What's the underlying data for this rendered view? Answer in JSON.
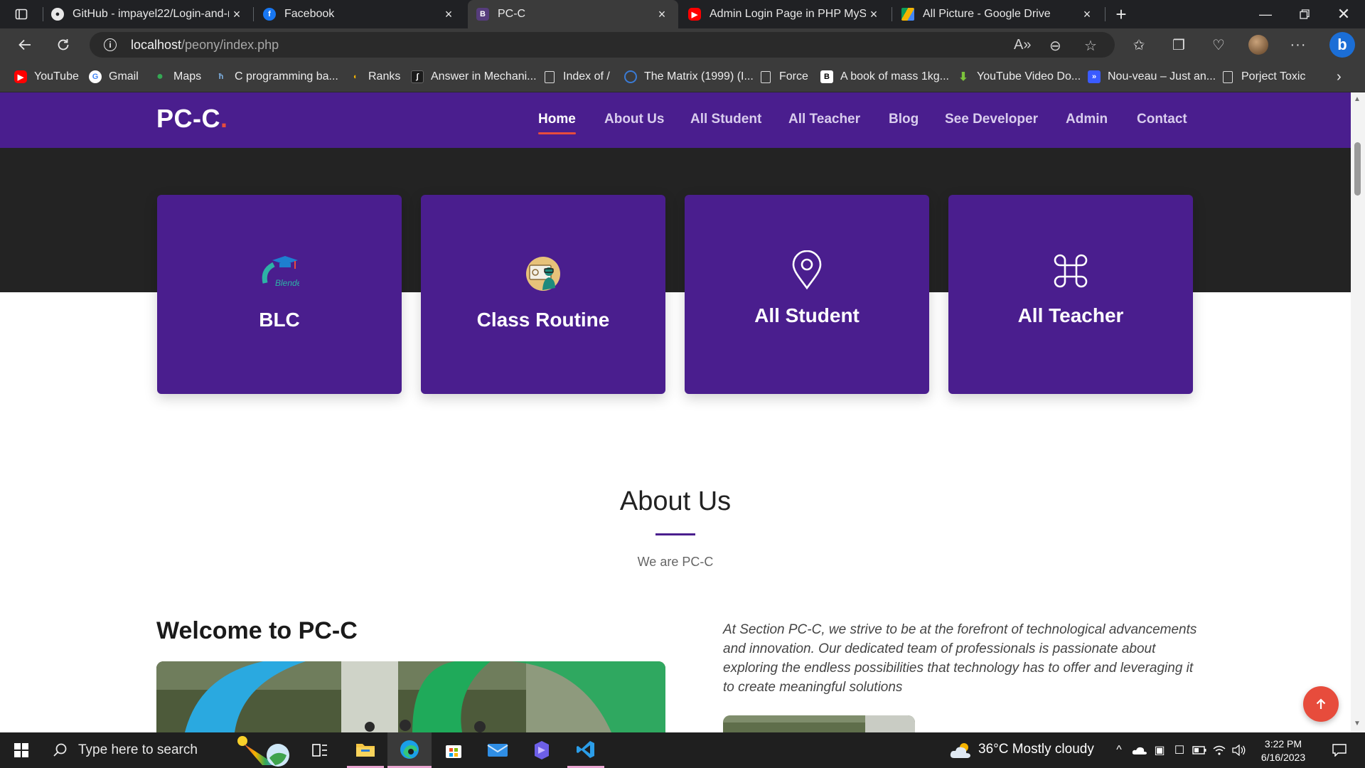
{
  "browser": {
    "tabs": [
      {
        "title": "GitHub - impayel22/Login-and-r",
        "icon": "github-icon",
        "active": false
      },
      {
        "title": "Facebook",
        "icon": "facebook-icon",
        "active": false
      },
      {
        "title": "PC-C",
        "icon": "bootstrap-icon",
        "active": true
      },
      {
        "title": "Admin Login Page in PHP MySQL",
        "icon": "youtube-icon",
        "active": false
      },
      {
        "title": "All Picture - Google Drive",
        "icon": "google-drive-icon",
        "active": false
      }
    ],
    "url_host": "localhost",
    "url_path": "/peony/index.php",
    "bookmarks": [
      {
        "label": "YouTube",
        "icon": "youtube-icon"
      },
      {
        "label": "Gmail",
        "icon": "google-icon"
      },
      {
        "label": "Maps",
        "icon": "maps-icon"
      },
      {
        "label": "C programming ba...",
        "icon": "site-icon"
      },
      {
        "label": "Ranks",
        "icon": "ranks-icon"
      },
      {
        "label": "Answer in Mechani...",
        "icon": "answer-icon"
      },
      {
        "label": "Index of /",
        "icon": "page-icon"
      },
      {
        "label": "The Matrix (1999) (I...",
        "icon": "matrix-icon"
      },
      {
        "label": "Force",
        "icon": "page-icon"
      },
      {
        "label": "A book of mass 1kg...",
        "icon": "brainly-icon"
      },
      {
        "label": "YouTube Video Do...",
        "icon": "download-icon"
      },
      {
        "label": "Nou-veau – Just an...",
        "icon": "nouveau-icon"
      },
      {
        "label": "Porject Toxic",
        "icon": "page-icon"
      }
    ]
  },
  "site": {
    "logo": "PC-C",
    "logo_dot": ".",
    "menu": [
      "Home",
      "About Us",
      "All Student",
      "All Teacher",
      "Blog",
      "See Developer",
      "Admin",
      "Contact"
    ],
    "active_menu": "Home",
    "cards": [
      {
        "title": "BLC",
        "icon": "blended-learning-icon"
      },
      {
        "title": "Class Routine",
        "icon": "class-routine-icon"
      },
      {
        "title": "All Student",
        "icon": "location-pin-icon"
      },
      {
        "title": "All Teacher",
        "icon": "command-icon"
      }
    ],
    "about": {
      "title": "About Us",
      "subtitle": "We are PC-C"
    },
    "welcome_title": "Welcome to PC-C",
    "intro": "At Section PC-C, we strive to be at the forefront of technological advancements and innovation. Our dedicated team of professionals is passionate about exploring the endless possibilities that technology has to offer and leveraging it to create meaningful solutions",
    "blc_icon_text": "Blended"
  },
  "taskbar": {
    "search_placeholder": "Type here to search",
    "weather": "36°C  Mostly cloudy",
    "time": "3:22 PM",
    "date": "6/16/2023"
  },
  "colors": {
    "brand_purple": "#4a1e8e",
    "accent_red": "#e74c3c",
    "hero_dark": "#232323"
  }
}
